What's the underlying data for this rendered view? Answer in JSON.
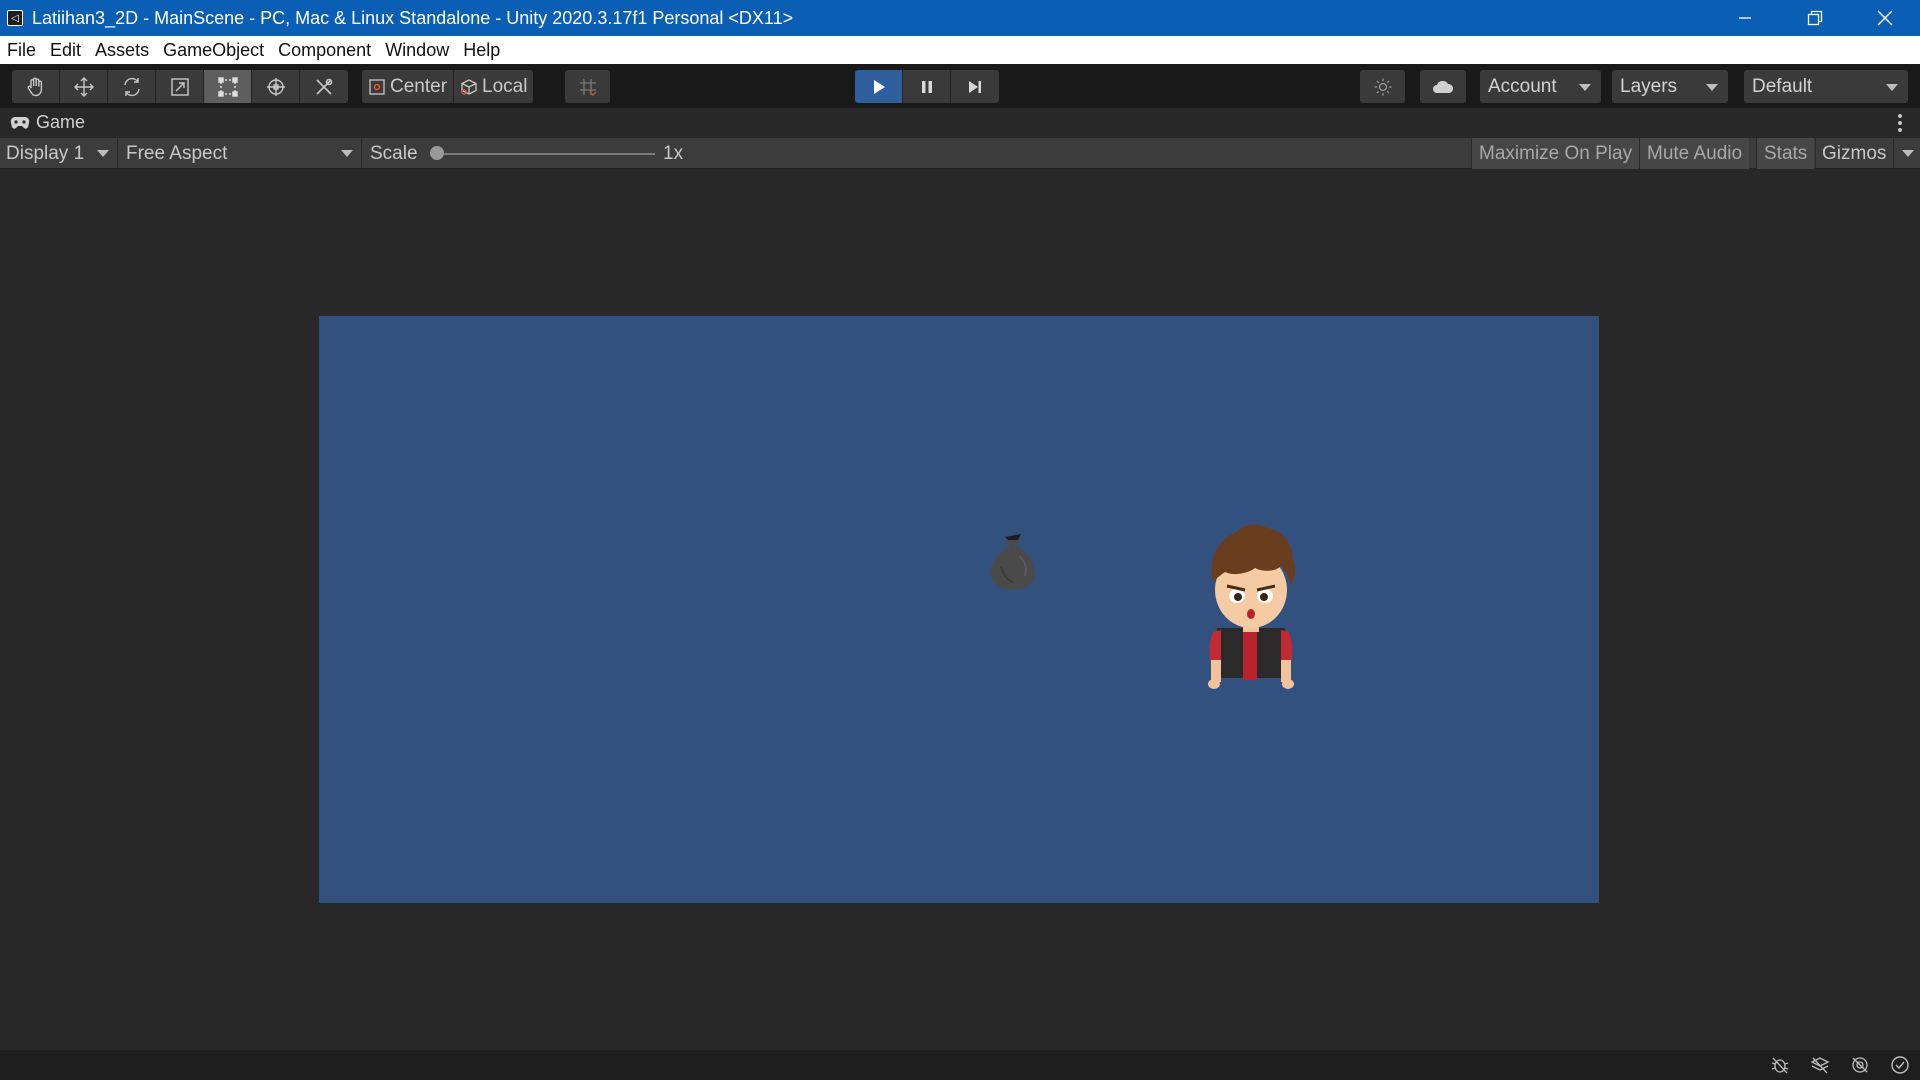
{
  "window": {
    "title": "Latiihan3_2D - MainScene - PC, Mac & Linux Standalone - Unity 2020.3.17f1 Personal <DX11>",
    "controls": [
      "minimize",
      "restore",
      "close"
    ]
  },
  "menu": {
    "items": [
      "File",
      "Edit",
      "Assets",
      "GameObject",
      "Component",
      "Window",
      "Help"
    ]
  },
  "toolbar": {
    "tools": [
      {
        "icon": "hand-icon",
        "active": false
      },
      {
        "icon": "move-icon",
        "active": false
      },
      {
        "icon": "rotate-icon",
        "active": false
      },
      {
        "icon": "scale-icon",
        "active": false
      },
      {
        "icon": "rect-icon",
        "active": true
      },
      {
        "icon": "transform-icon",
        "active": false
      },
      {
        "icon": "custom-tool-icon",
        "active": false
      }
    ],
    "pivot_label": "Center",
    "space_label": "Local",
    "play_active": true,
    "account_label": "Account",
    "layers_label": "Layers",
    "layout_label": "Default"
  },
  "game_tab": {
    "label": "Game"
  },
  "game_bar": {
    "display": "Display 1",
    "aspect": "Free Aspect",
    "scale_label": "Scale",
    "scale_value": "1x",
    "maximize_on_play": "Maximize On Play",
    "mute_audio": "Mute Audio",
    "stats": "Stats",
    "gizmos": "Gizmos"
  },
  "colors": {
    "titlebar": "#0a5fb4",
    "game_background": "#33517f",
    "play_active": "#2f5f9c"
  }
}
